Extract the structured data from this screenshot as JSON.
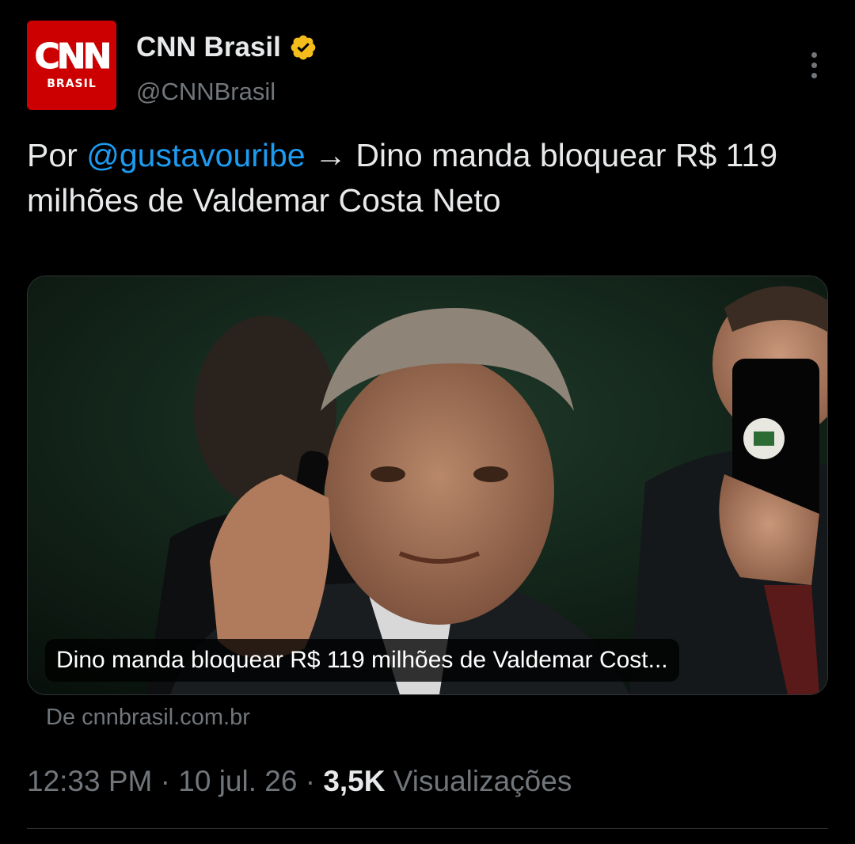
{
  "author": {
    "display_name": "CNN Brasil",
    "handle": "@CNNBrasil",
    "avatar_logo": "CNN",
    "avatar_subtitle": "BRASIL",
    "verified": true,
    "verified_color": "#f4bd1b"
  },
  "tweet": {
    "prefix": "Por",
    "mention": "@gustavouribe",
    "body": "→ Dino manda bloquear R$ 119 milhões de Valdemar Costa Neto"
  },
  "card": {
    "caption": "Dino manda bloquear R$ 119 milhões de Valdemar Cost...",
    "source": "De cnnbrasil.com.br"
  },
  "meta": {
    "time": "12:33 PM",
    "date": "10 jul. 26",
    "views_count": "3,5K",
    "views_label": "Visualizações",
    "separator": "·"
  },
  "colors": {
    "background": "#000000",
    "text": "#e7e9ea",
    "secondary": "#71767b",
    "link": "#1d9bf0",
    "brand_red": "#cc0000"
  },
  "icons": {
    "verified": "verified-badge-icon",
    "more": "more-options-icon"
  }
}
